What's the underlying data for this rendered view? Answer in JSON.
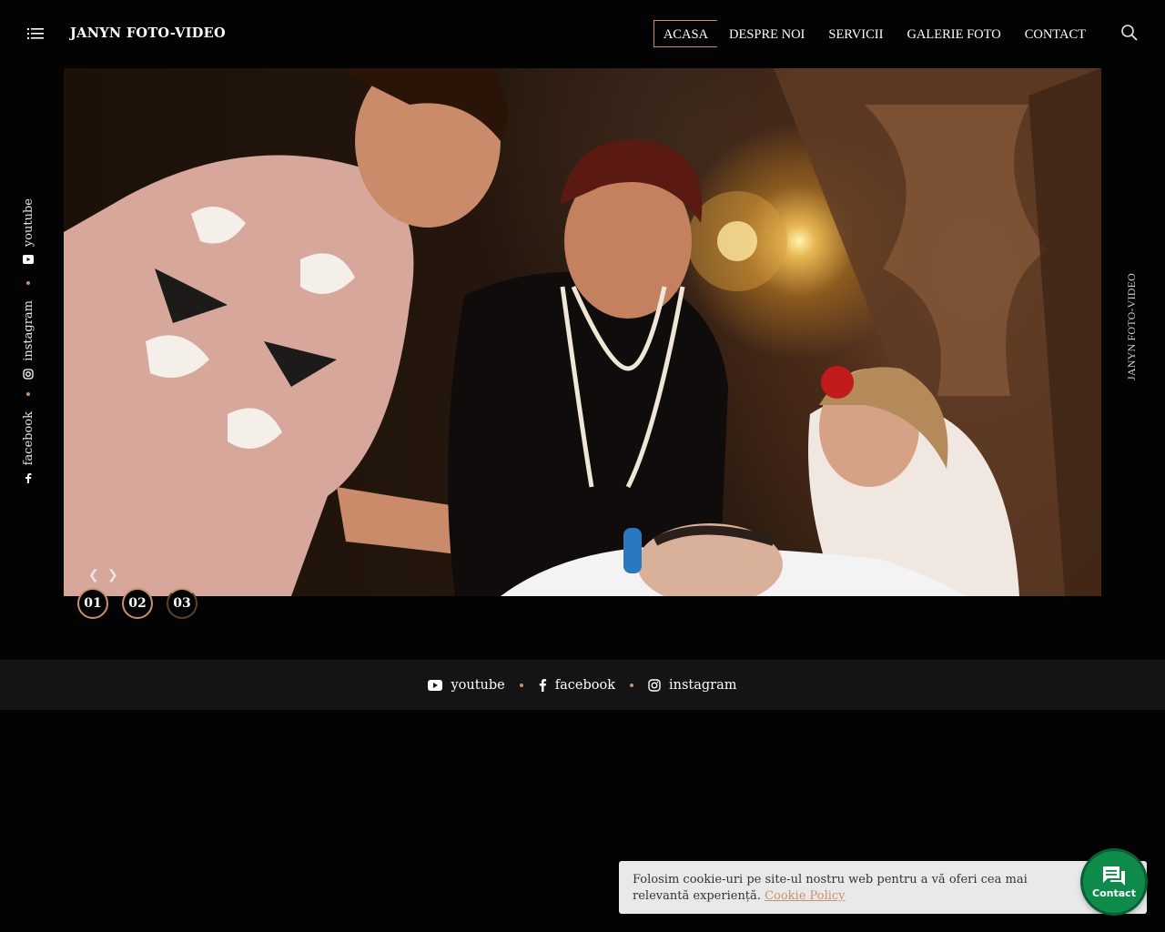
{
  "header": {
    "brand": "JANYN FOTO-VIDEO",
    "nav": [
      "ACASA",
      "DESPRE NOI",
      "SERVICII",
      "GALERIE FOTO",
      "CONTACT"
    ],
    "active_nav": "ACASA",
    "icons": {
      "menu": "list-icon",
      "search": "search-icon"
    }
  },
  "hero": {
    "slides": [
      "01",
      "02",
      "03"
    ],
    "icons": {
      "prev": "chevron-left-icon",
      "next": "chevron-right-icon"
    }
  },
  "side_social": [
    {
      "label": "youtube",
      "icon": "youtube-icon"
    },
    {
      "label": "instagram",
      "icon": "instagram-icon"
    },
    {
      "label": "facebook",
      "icon": "facebook-icon"
    }
  ],
  "side_right_text": "JANYN FOTO-VIDEO",
  "footer_social": [
    {
      "label": "youtube",
      "icon": "youtube-icon"
    },
    {
      "label": "facebook",
      "icon": "facebook-icon"
    },
    {
      "label": "instagram",
      "icon": "instagram-icon"
    }
  ],
  "cookie": {
    "text": "Folosim cookie-uri pe site-ul nostru web pentru a vă oferi cea mai relevantă experiență.",
    "link": "Cookie Policy"
  },
  "contact_button": {
    "label": "Contact",
    "icon": "chat-icon"
  },
  "colors": {
    "accent": "#c9906c",
    "background": "#030303",
    "footer": "#141414",
    "contact": "#0e8a4a"
  }
}
